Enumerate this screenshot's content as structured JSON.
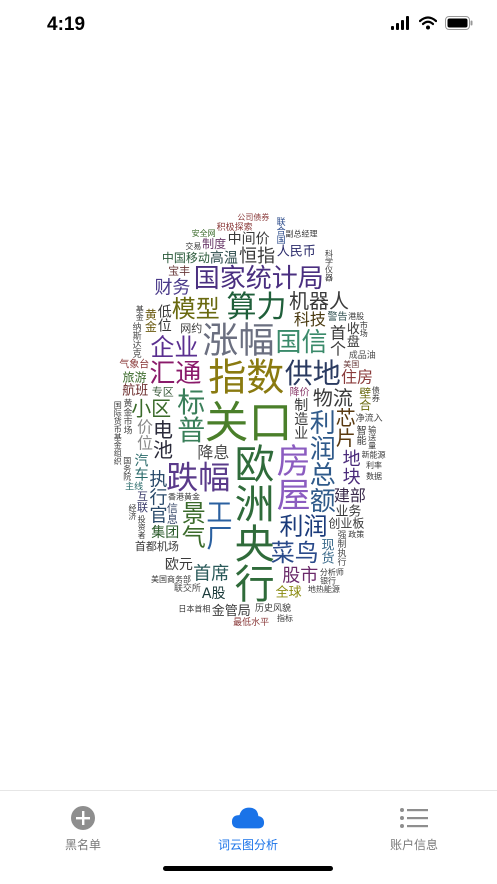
{
  "status": {
    "time": "4:19"
  },
  "wordcloud": {
    "words": [
      {
        "t": "关口",
        "c": "#4a7f2a",
        "s": 44
      },
      {
        "t": "欧洲央行",
        "c": "#2f6b3a",
        "s": 40
      },
      {
        "t": "指数",
        "c": "#8a7a10",
        "s": 38
      },
      {
        "t": "涨幅",
        "c": "#6b6f80",
        "s": 36
      },
      {
        "t": "房屋",
        "c": "#8b5cc0",
        "s": 34
      },
      {
        "t": "跌幅",
        "c": "#5a3a8a",
        "s": 32
      },
      {
        "t": "算力",
        "c": "#1f5f3a",
        "s": 30
      },
      {
        "t": "标普",
        "c": "#3a7f5a",
        "s": 28
      },
      {
        "t": "供地",
        "c": "#2a3a60",
        "s": 28
      },
      {
        "t": "国家统计局",
        "c": "#4a2f80",
        "s": 26
      },
      {
        "t": "利润总额",
        "c": "#2f5a8a",
        "s": 26
      },
      {
        "t": "国信",
        "c": "#3a8a6a",
        "s": 26
      },
      {
        "t": "汇通",
        "c": "#8a1a6a",
        "s": 26
      },
      {
        "t": "工厂",
        "c": "#2a60a0",
        "s": 26
      },
      {
        "t": "利润",
        "c": "#1a3a7a",
        "s": 24
      },
      {
        "t": "企业",
        "c": "#5a2f90",
        "s": 24
      },
      {
        "t": "景气",
        "c": "#3a6a2a",
        "s": 24
      },
      {
        "t": "模型",
        "c": "#6a6a10",
        "s": 24
      },
      {
        "t": "菜鸟",
        "c": "#2a4a8a",
        "s": 24
      },
      {
        "t": "电池",
        "c": "#2a2a3a",
        "s": 20
      },
      {
        "t": "物流",
        "c": "#3a3a3a",
        "s": 20
      },
      {
        "t": "机器人",
        "c": "#3a3a3a",
        "s": 20
      },
      {
        "t": "芯片",
        "c": "#5a3a10",
        "s": 20
      },
      {
        "t": "小区",
        "c": "#3a6a2a",
        "s": 20
      },
      {
        "t": "首席",
        "c": "#2a5a5a",
        "s": 18
      },
      {
        "t": "执行官",
        "c": "#2a4a6a",
        "s": 18
      },
      {
        "t": "恒指",
        "c": "#3a3a3a",
        "s": 18
      },
      {
        "t": "股市",
        "c": "#6a2a6a",
        "s": 18
      },
      {
        "t": "地块",
        "c": "#4a2a7a",
        "s": 18
      },
      {
        "t": "财务",
        "c": "#4a3a8a",
        "s": 18
      },
      {
        "t": "降息",
        "c": "#4a4a4a",
        "s": 16
      },
      {
        "t": "首个",
        "c": "#3a3a3a",
        "s": 16
      },
      {
        "t": "科技",
        "c": "#4a3a10",
        "s": 16
      },
      {
        "t": "建部",
        "c": "#3a2a4a",
        "s": 16
      },
      {
        "t": "价位",
        "c": "#8a8a8a",
        "s": 16
      },
      {
        "t": "住房",
        "c": "#8a3a3a",
        "s": 16
      },
      {
        "t": "高温",
        "c": "#2a4a4a",
        "s": 14
      },
      {
        "t": "制造业",
        "c": "#3a3a3a",
        "s": 14
      },
      {
        "t": "集团",
        "c": "#2a5a2a",
        "s": 14
      },
      {
        "t": "A股",
        "c": "#1a3a3a",
        "s": 14
      },
      {
        "t": "低位",
        "c": "#3a3a3a",
        "s": 14
      },
      {
        "t": "欧元",
        "c": "#3a3a3a",
        "s": 14
      },
      {
        "t": "中间价",
        "c": "#3a3a3a",
        "s": 14
      },
      {
        "t": "汽车",
        "c": "#2a6a6a",
        "s": 14
      },
      {
        "t": "业务",
        "c": "#3a3a3a",
        "s": 13
      },
      {
        "t": "全球",
        "c": "#8a8a10",
        "s": 13
      },
      {
        "t": "现货",
        "c": "#3a6a8a",
        "s": 13
      },
      {
        "t": "航班",
        "c": "#6a2a2a",
        "s": 13
      },
      {
        "t": "人民币",
        "c": "#2a2a6a",
        "s": 13
      },
      {
        "t": "收盘",
        "c": "#3a3a3a",
        "s": 13
      },
      {
        "t": "金管局",
        "c": "#3a3a3a",
        "s": 13
      },
      {
        "t": "中国移动",
        "c": "#2a5a3a",
        "s": 12
      },
      {
        "t": "首都机场",
        "c": "#3a3a3a",
        "s": 11
      },
      {
        "t": "黄金",
        "c": "#6a5a10",
        "s": 12
      },
      {
        "t": "制度",
        "c": "#6a3a6a",
        "s": 12
      },
      {
        "t": "信息",
        "c": "#3a4a6a",
        "s": 11
      },
      {
        "t": "网约",
        "c": "#3a3a3a",
        "s": 11
      },
      {
        "t": "专区",
        "c": "#3a5a3a",
        "s": 11
      },
      {
        "t": "气象台",
        "c": "#8a3a3a",
        "s": 10
      },
      {
        "t": "创业板",
        "c": "#3a3a3a",
        "s": 12
      },
      {
        "t": "壁合",
        "c": "#6a6a10",
        "s": 12
      },
      {
        "t": "旅游",
        "c": "#3a6a2a",
        "s": 12
      },
      {
        "t": "互联",
        "c": "#3a3a6a",
        "s": 11
      },
      {
        "t": "宝丰",
        "c": "#6a3a3a",
        "s": 11
      },
      {
        "t": "智能",
        "c": "#3a3a3a",
        "s": 10
      },
      {
        "t": "降价",
        "c": "#8a3a6a",
        "s": 10
      },
      {
        "t": "警告",
        "c": "#2a4a4a",
        "s": 10
      },
      {
        "t": "强制执行",
        "c": "#4a4a4a",
        "s": 9
      },
      {
        "t": "历史风貌",
        "c": "#3a3a3a",
        "s": 9
      },
      {
        "t": "净流入",
        "c": "#4a4a4a",
        "s": 9
      },
      {
        "t": "黄金市场",
        "c": "#4a4a4a",
        "s": 9
      },
      {
        "t": "成品油",
        "c": "#4a4a4a",
        "s": 9
      },
      {
        "t": "联交所",
        "c": "#4a4a4a",
        "s": 9
      },
      {
        "t": "纳斯达克",
        "c": "#4a4a4a",
        "s": 9
      },
      {
        "t": "积极探索",
        "c": "#8a3a3a",
        "s": 9
      },
      {
        "t": "主线",
        "c": "#2a6a6a",
        "s": 9
      },
      {
        "t": "联合国",
        "c": "#2a4a8a",
        "s": 9
      },
      {
        "t": "最低水平",
        "c": "#8a3a3a",
        "s": 9
      },
      {
        "t": "香港黄金",
        "c": "#3a3a3a",
        "s": 8
      },
      {
        "t": "输送量",
        "c": "#3a3a3a",
        "s": 8
      },
      {
        "t": "美国商务部",
        "c": "#3a3a3a",
        "s": 8
      },
      {
        "t": "分析师",
        "c": "#3a3a3a",
        "s": 8
      },
      {
        "t": "国际货币基金组织",
        "c": "#3a3a3a",
        "s": 8
      },
      {
        "t": "公司债券",
        "c": "#8a3a3a",
        "s": 8
      },
      {
        "t": "副总经理",
        "c": "#3a3a3a",
        "s": 8
      },
      {
        "t": "国务院",
        "c": "#3a3a3a",
        "s": 8
      },
      {
        "t": "地热能源",
        "c": "#3a3a3a",
        "s": 8
      },
      {
        "t": "日本首相",
        "c": "#3a3a3a",
        "s": 8
      },
      {
        "t": "科学仪器",
        "c": "#3a3a3a",
        "s": 8
      },
      {
        "t": "安全网",
        "c": "#3a6a2a",
        "s": 8
      },
      {
        "t": "美国",
        "c": "#6a3a3a",
        "s": 8
      },
      {
        "t": "投资者",
        "c": "#3a3a3a",
        "s": 8
      },
      {
        "t": "交易",
        "c": "#3a3a3a",
        "s": 8
      },
      {
        "t": "新能源",
        "c": "#3a3a3a",
        "s": 8
      },
      {
        "t": "基金",
        "c": "#3a3a3a",
        "s": 8
      },
      {
        "t": "港股",
        "c": "#3a3a3a",
        "s": 8
      },
      {
        "t": "银行",
        "c": "#3a3a3a",
        "s": 8
      },
      {
        "t": "债券",
        "c": "#3a3a3a",
        "s": 8
      },
      {
        "t": "利率",
        "c": "#3a3a3a",
        "s": 8
      },
      {
        "t": "政策",
        "c": "#3a3a3a",
        "s": 8
      },
      {
        "t": "市场",
        "c": "#3a3a3a",
        "s": 8
      },
      {
        "t": "指标",
        "c": "#3a3a3a",
        "s": 8
      },
      {
        "t": "数据",
        "c": "#3a3a3a",
        "s": 8
      },
      {
        "t": "经济",
        "c": "#3a3a3a",
        "s": 8
      }
    ]
  },
  "tabs": [
    {
      "label": "黑名单",
      "icon": "plus-circle-icon",
      "active": false
    },
    {
      "label": "词云图分析",
      "icon": "cloud-icon",
      "active": true
    },
    {
      "label": "账户信息",
      "icon": "list-icon",
      "active": false
    }
  ],
  "colors": {
    "accent": "#1a73e8",
    "inactive": "#7a7a7a"
  }
}
